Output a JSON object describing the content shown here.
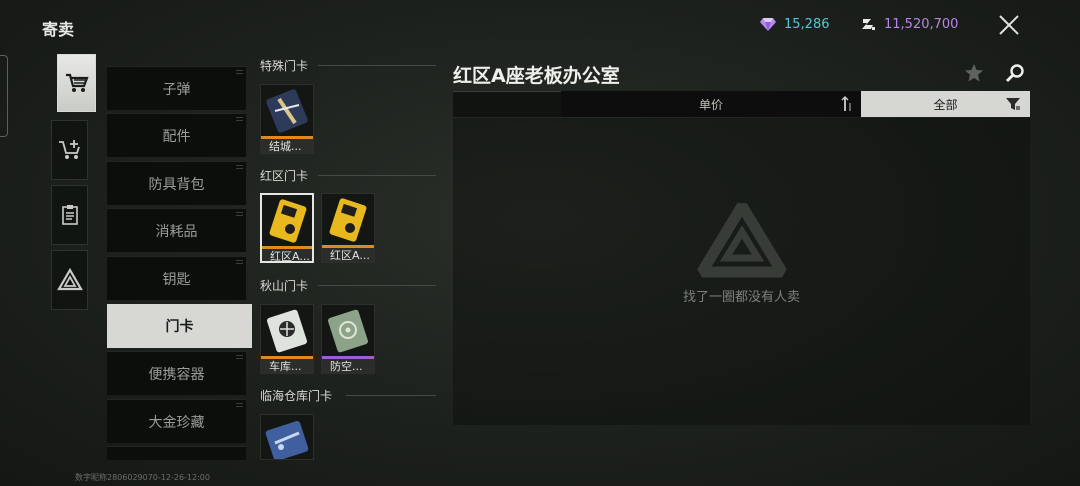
{
  "header": {
    "title": "寄卖",
    "diamond_amount": "15,286",
    "coin_amount": "11,520,700"
  },
  "colors": {
    "diamond": "#56c7d6",
    "coin": "#b985e8",
    "quality_orange": "#e08a1e",
    "quality_purple": "#a35ad6"
  },
  "icon_tabs": [
    {
      "icon": "shopping-cart-icon",
      "active": true
    },
    {
      "icon": "cart-sell-icon",
      "active": false
    },
    {
      "icon": "clipboard-icon",
      "active": false
    },
    {
      "icon": "triangle-logo-icon",
      "active": false
    }
  ],
  "categories": [
    {
      "label": "子弹",
      "active": false
    },
    {
      "label": "配件",
      "active": false
    },
    {
      "label": "防具背包",
      "active": false
    },
    {
      "label": "消耗品",
      "active": false
    },
    {
      "label": "钥匙",
      "active": false
    },
    {
      "label": "门卡",
      "active": true
    },
    {
      "label": "便携容器",
      "active": false
    },
    {
      "label": "大金珍藏",
      "active": false
    }
  ],
  "item_sections": [
    {
      "title": "特殊门卡",
      "items": [
        {
          "name": "结城...",
          "quality": "orange",
          "selected": false
        }
      ]
    },
    {
      "title": "红区门卡",
      "items": [
        {
          "name": "红区A...",
          "quality": "orange",
          "selected": true
        },
        {
          "name": "红区A...",
          "quality": "orange",
          "selected": false
        }
      ]
    },
    {
      "title": "秋山门卡",
      "items": [
        {
          "name": "车库...",
          "quality": "orange",
          "selected": false
        },
        {
          "name": "防空...",
          "quality": "purple",
          "selected": false
        }
      ]
    },
    {
      "title": "临海仓库门卡",
      "items": [
        {
          "name": "",
          "quality": "",
          "selected": false
        }
      ]
    }
  ],
  "detail": {
    "title": "红区A座老板办公室",
    "sort_label": "单价",
    "filter_label": "全部",
    "empty_text": "找了一圈都没有人卖"
  },
  "footer": {
    "text": "数字昵称2806029070-12-26-12:00"
  }
}
